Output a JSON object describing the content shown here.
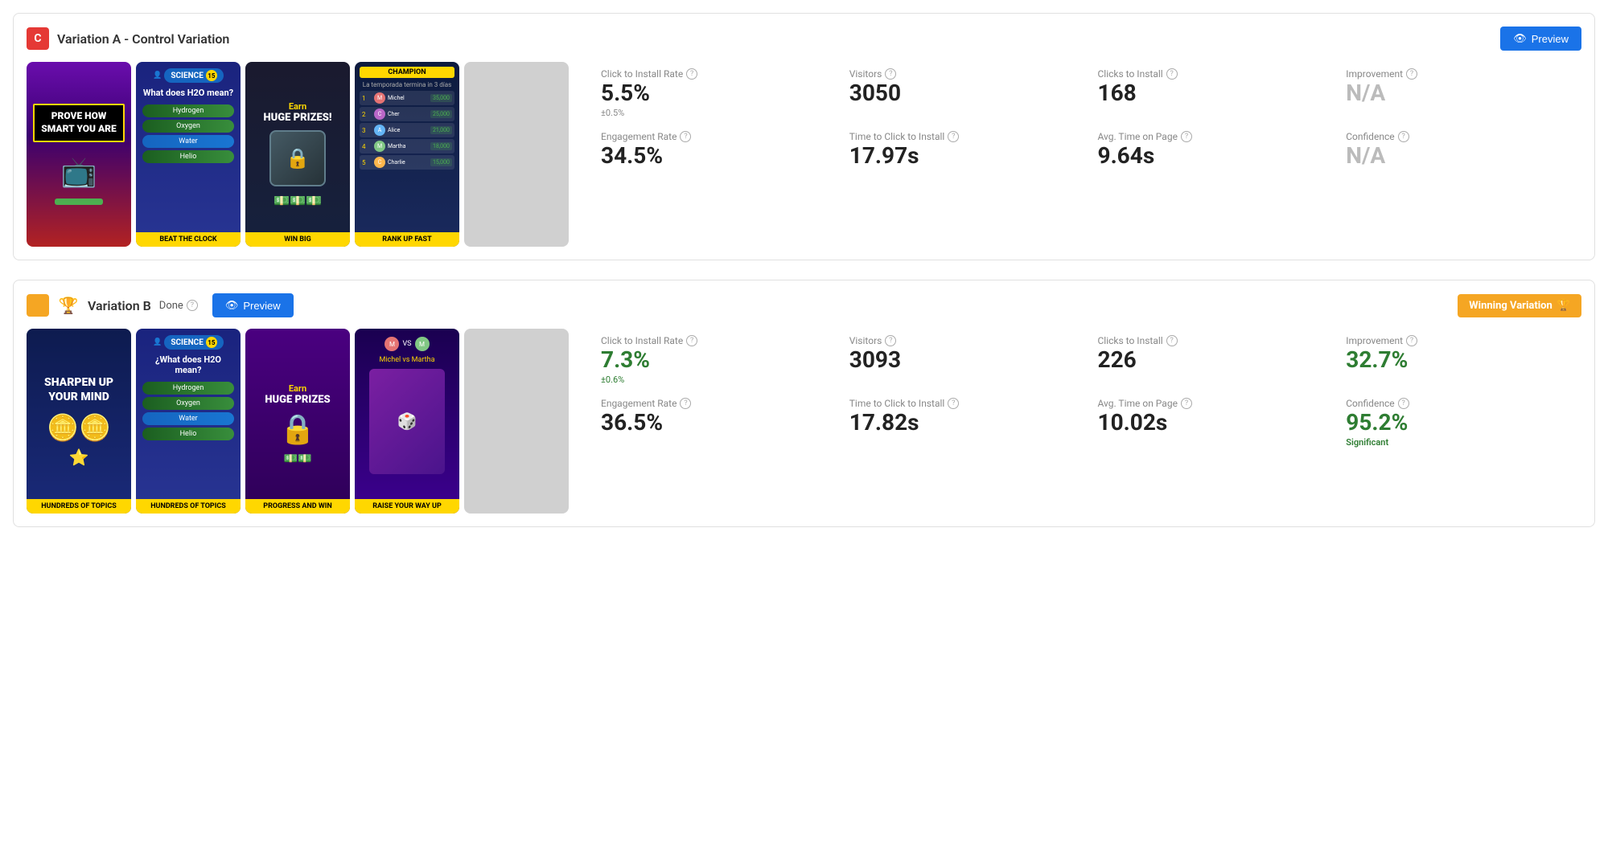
{
  "variationA": {
    "icon": "C",
    "title": "Variation A - Control Variation",
    "previewLabel": "Preview",
    "screenshots": [
      {
        "label": "",
        "topText": "PROVE HOW SMART YOU ARE",
        "bottomLabel": ""
      },
      {
        "label": "BEAT THE CLOCK",
        "scienceLabel": "SCIENCE",
        "scienceNum": "15",
        "question": "What does H2O mean?",
        "options": [
          "Hydrogen",
          "Oxygen",
          "Water",
          "Helio"
        ],
        "selectedIndex": 2
      },
      {
        "label": "WIN BIG",
        "earnText": "Earn",
        "prizesText": "HUGE PRIZES!"
      },
      {
        "label": "RANK UP FAST",
        "championText": "CHAMPION",
        "rows": [
          {
            "rank": "1",
            "name": "Michel",
            "score": "35,000",
            "color": "#e57373"
          },
          {
            "rank": "2",
            "name": "Cher",
            "score": "25,000",
            "color": "#ba68c8"
          },
          {
            "rank": "3",
            "name": "Alice",
            "score": "21,000",
            "color": "#64b5f6"
          },
          {
            "rank": "4",
            "name": "Martha",
            "score": "18,000",
            "color": "#81c784"
          },
          {
            "rank": "5",
            "name": "Charlie",
            "score": "15,000",
            "color": "#ffb74d"
          }
        ]
      }
    ],
    "stats": {
      "clickToInstallRate": {
        "label": "Click to Install Rate",
        "value": "5.5%",
        "sub": "±0.5%"
      },
      "visitors": {
        "label": "Visitors",
        "value": "3050"
      },
      "clicksToInstall": {
        "label": "Clicks to Install",
        "value": "168"
      },
      "improvement": {
        "label": "Improvement",
        "value": "N/A"
      },
      "engagementRate": {
        "label": "Engagement Rate",
        "value": "34.5%"
      },
      "timeToClickToInstall": {
        "label": "Time to Click to Install",
        "value": "17.97s"
      },
      "avgTimeOnPage": {
        "label": "Avg. Time on Page",
        "value": "9.64s"
      },
      "confidence": {
        "label": "Confidence",
        "value": "N/A"
      }
    }
  },
  "variationB": {
    "iconColor": "#F5A623",
    "title": "Variation B",
    "doneLabel": "Done",
    "previewLabel": "Preview",
    "winningLabel": "Winning Variation",
    "screenshots": [
      {
        "topText": "SHARPEN UP Your MIND",
        "bottomLabel": "HUNDREDS OF TOPICS"
      },
      {
        "label": "HUNDREDS OF TOPICS",
        "scienceLabel": "SCIENCE",
        "scienceNum": "15",
        "question": "¿What does H2O mean?",
        "options": [
          "Hydrogen",
          "Oxygen",
          "Water",
          "Helio"
        ],
        "selectedIndex": 2
      },
      {
        "label": "PROGRESS AND WIN",
        "earnText": "Earn",
        "prizesText": "HUGE PRIZES"
      },
      {
        "label": "RAISE YOUR WAY UP",
        "topName1": "Michel",
        "topName2": "Martha"
      }
    ],
    "stats": {
      "clickToInstallRate": {
        "label": "Click to Install Rate",
        "value": "7.3%",
        "sub": "±0.6%",
        "green": true
      },
      "visitors": {
        "label": "Visitors",
        "value": "3093"
      },
      "clicksToInstall": {
        "label": "Clicks to Install",
        "value": "226"
      },
      "improvement": {
        "label": "Improvement",
        "value": "32.7%",
        "green": true
      },
      "engagementRate": {
        "label": "Engagement Rate",
        "value": "36.5%"
      },
      "timeToClickToInstall": {
        "label": "Time to Click to Install",
        "value": "17.82s"
      },
      "avgTimeOnPage": {
        "label": "Avg. Time on Page",
        "value": "10.02s"
      },
      "confidence": {
        "label": "Confidence",
        "value": "95.2%",
        "green": true,
        "sub": "Significant"
      }
    }
  },
  "icons": {
    "eye": "👁",
    "info": "?",
    "trophy": "🏆"
  }
}
